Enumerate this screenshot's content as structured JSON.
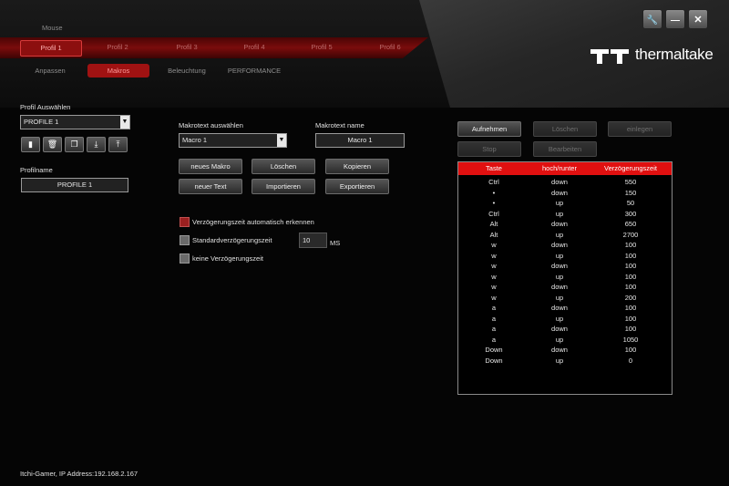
{
  "device": "Mouse",
  "brand": "thermaltake",
  "window_controls": {
    "tools": "🔧",
    "minimize": "—",
    "close": "✕"
  },
  "profile_tabs": [
    "Profil 1",
    "Profil 2",
    "Profil 3",
    "Profil 4",
    "Profil 5",
    "Profil 6"
  ],
  "active_profile_tab": "Profil 1",
  "section_tabs": [
    "Anpassen",
    "Makros",
    "Beleuchtung",
    "PERFORMANCE"
  ],
  "active_section_tab": "Makros",
  "left": {
    "profile_select_label": "Profil Auswählen",
    "profile_select_value": "PROFILE 1",
    "profile_icons": [
      "save-icon",
      "trash-icon",
      "copy-icon",
      "download-icon",
      "upload-icon"
    ],
    "profilename_label": "Profilname",
    "profilename_value": "PROFILE 1"
  },
  "macro": {
    "select_label": "Makrotext auswählen",
    "select_value": "Macro 1",
    "name_label": "Makrotext name",
    "name_value": "Macro 1",
    "buttons": {
      "new_macro": "neues Makro",
      "delete": "Löschen",
      "copy": "Kopieren",
      "new_text": "neuer Text",
      "import": "Importieren",
      "export": "Exportieren"
    },
    "options": {
      "auto_delay": "Verzögerungszeit automatisch erkennen",
      "auto_delay_checked": true,
      "standard_delay": "Standardverzögerungszeit",
      "standard_delay_checked": false,
      "standard_delay_value": "10",
      "standard_delay_unit": "MS",
      "no_delay": "keine Verzögerungszeit",
      "no_delay_checked": false
    }
  },
  "record": {
    "record": "Aufnehmen",
    "delete": "Löschen",
    "insert": "einlegen",
    "stop": "Stop",
    "edit": "Bearbeiten"
  },
  "table": {
    "headers": [
      "Taste",
      "hoch/runter",
      "Verzögerungszeit"
    ],
    "rows": [
      [
        "Ctrl",
        "down",
        "550"
      ],
      [
        "•",
        "down",
        "150"
      ],
      [
        "•",
        "up",
        "50"
      ],
      [
        "Ctrl",
        "up",
        "300"
      ],
      [
        "Alt",
        "down",
        "650"
      ],
      [
        "Alt",
        "up",
        "2700"
      ],
      [
        "w",
        "down",
        "100"
      ],
      [
        "w",
        "up",
        "100"
      ],
      [
        "w",
        "down",
        "100"
      ],
      [
        "w",
        "up",
        "100"
      ],
      [
        "w",
        "down",
        "100"
      ],
      [
        "w",
        "up",
        "200"
      ],
      [
        "a",
        "down",
        "100"
      ],
      [
        "a",
        "up",
        "100"
      ],
      [
        "a",
        "down",
        "100"
      ],
      [
        "a",
        "up",
        "1050"
      ],
      [
        "Down",
        "down",
        "100"
      ],
      [
        "Down",
        "up",
        "0"
      ]
    ]
  },
  "footer": "Itchi-Gamer, IP Address:192.168.2.167",
  "colors": {
    "accent": "#e01010",
    "tab_red": "#8c0f0f"
  }
}
